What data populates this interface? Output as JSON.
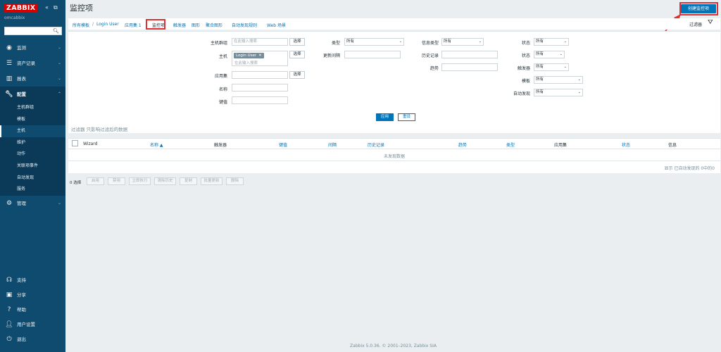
{
  "app": {
    "logo": "ZABBIX",
    "server_name": "omcabbix",
    "collapse_icon": "«",
    "kiosk_icon": "⧉"
  },
  "sidebar": {
    "menu": [
      {
        "label": "监测",
        "icon": "eye-icon"
      },
      {
        "label": "资产记录",
        "icon": "list-icon"
      },
      {
        "label": "报表",
        "icon": "chart-icon"
      },
      {
        "label": "配置",
        "icon": "wrench-icon"
      }
    ],
    "submenu": [
      "主机群组",
      "模板",
      "主机",
      "维护",
      "动作",
      "关联项事件",
      "自动发现",
      "服务"
    ],
    "admin": {
      "label": "管理",
      "icon": "gear-icon"
    },
    "bottom": [
      {
        "label": "支持",
        "icon": "headset-icon"
      },
      {
        "label": "分享",
        "icon": "share-icon"
      },
      {
        "label": "帮助",
        "icon": "help-icon"
      },
      {
        "label": "用户设置",
        "icon": "user-icon"
      },
      {
        "label": "退出",
        "icon": "power-icon"
      }
    ]
  },
  "header": {
    "title": "监控项",
    "create_button": "创建监控项"
  },
  "nav": {
    "all_hosts": "所有模板",
    "separator": "/",
    "host": "Login User",
    "applications": "应用集 1",
    "items": "监控项",
    "triggers": "触发器",
    "graphs": "图形",
    "aggregate": "聚合图形",
    "discovery": "自动发现规则",
    "web": "Web 场景"
  },
  "filter": {
    "tab_label": "过滤器",
    "host_groups_label": "主机群组",
    "host_groups_placeholder": "在此输入搜索",
    "select_label": "选择",
    "hosts_label": "主机",
    "host_chip": "Login User",
    "chip_remove": "✕",
    "hosts_placeholder": "在此输入搜索",
    "application_label": "应用集",
    "application_select": "选择",
    "name_label": "名称",
    "key_label": "键值",
    "type_label": "类型",
    "type_value": "所有",
    "update_interval_label": "更新间隔",
    "info_type_label": "信息类型",
    "info_type_value": "所有",
    "history_label": "历史记录",
    "trends_label": "趋势",
    "state_label": "状态",
    "state_value": "所有",
    "status_label": "状态",
    "status_value": "所有",
    "triggers_label": "触发器",
    "triggers_value": "所有",
    "template_label": "模板",
    "template_value": "所有",
    "discovery_label": "自动发现",
    "discovery_value": "所有",
    "apply": "应用",
    "reset": "重设",
    "subfilter_prefix": "过滤器",
    "subfilter_text": "只影响过滤后的数据"
  },
  "table": {
    "columns": [
      "Wizard",
      "名称 ▲",
      "触发器",
      "键值",
      "间隔",
      "历史记录",
      "趋势",
      "类型",
      "应用集",
      "状态",
      "信息"
    ],
    "no_data": "未发现数据",
    "footer": "显示 已自动发现的 0中的0"
  },
  "actions": {
    "selected": "0 选择",
    "buttons": [
      "启用",
      "禁用",
      "立即执行",
      "清除历史",
      "复制",
      "批量更新",
      "删除"
    ]
  },
  "footer": "Zabbix 5.0.36. © 2001–2023, Zabbix SIA"
}
